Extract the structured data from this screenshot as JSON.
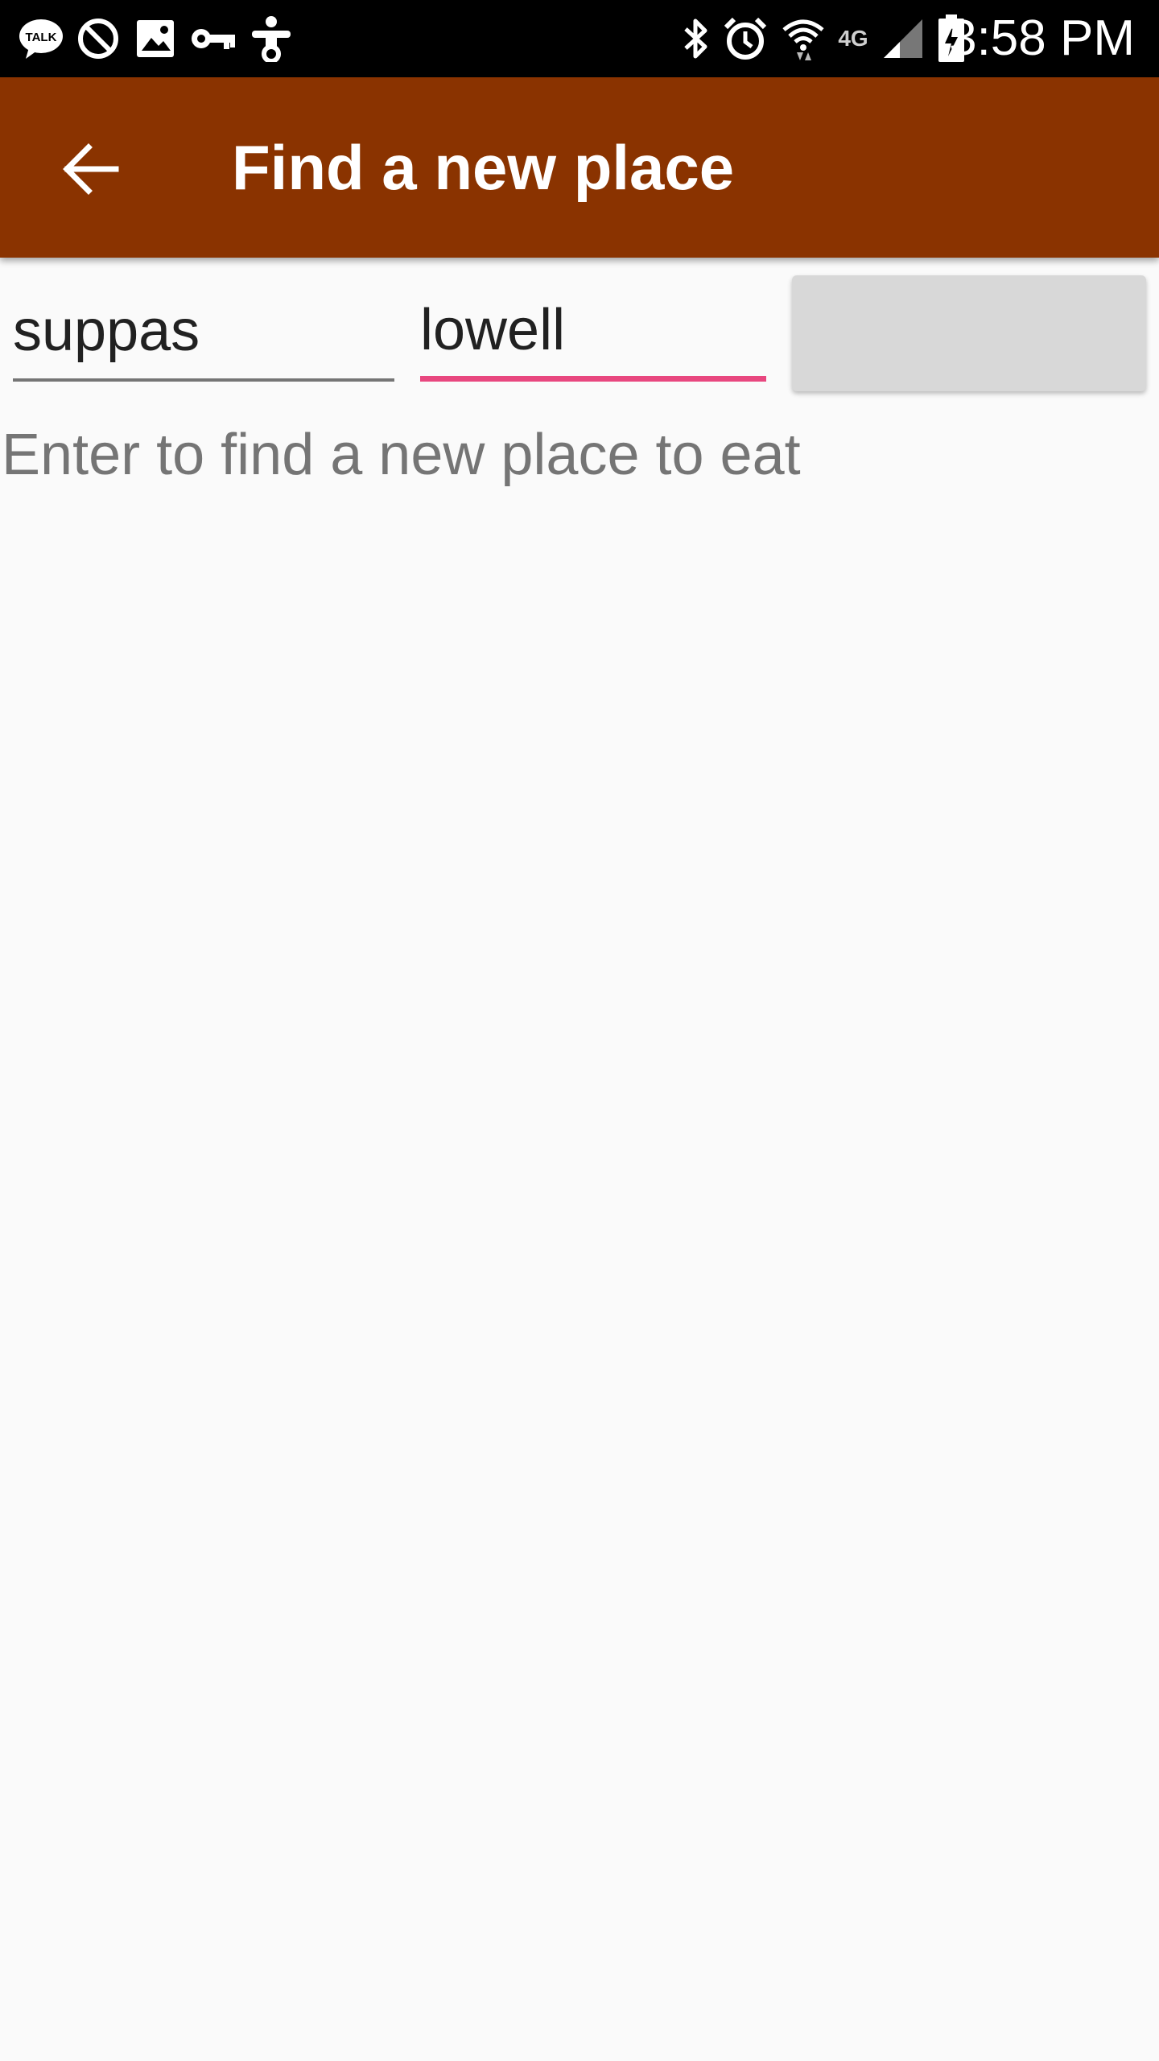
{
  "status_bar": {
    "time": "3:58 PM",
    "left_icons": [
      "talk-icon",
      "block-icon",
      "image-icon",
      "key-icon",
      "accessibility-icon"
    ],
    "right_icons": [
      "bluetooth-icon",
      "alarm-icon",
      "wifi-icon",
      "lte-icon",
      "signal-icon",
      "battery-charging-icon"
    ],
    "network_label": "4G"
  },
  "app_bar": {
    "title": "Find a new place",
    "back_icon": "arrow-back-icon"
  },
  "form": {
    "field_1_value": "suppas",
    "field_2_value": "lowell",
    "search_button_label": ""
  },
  "helper_text": "Enter to find a new place to eat",
  "colors": {
    "app_bar": "#8a3300",
    "input_focus_underline": "#e8477f",
    "background": "#fafafa",
    "button": "#d8d8d8"
  }
}
